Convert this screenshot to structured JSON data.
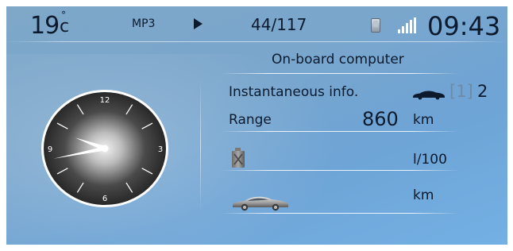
{
  "status_bar": {
    "temperature_value": "19",
    "temperature_unit": "c",
    "temperature_degree": "°",
    "audio_source": "MP3",
    "playback_icon": "play-icon",
    "track_position": "44/117",
    "phone_icon": "phone-icon",
    "signal_icon": "signal-strength-icon",
    "time": "09:43"
  },
  "trip_computer": {
    "title": "On-board computer",
    "info_label": "Instantaneous info.",
    "trip_selector": {
      "inactive": "[1]",
      "active": "2",
      "icon": "car-icon"
    },
    "range": {
      "label": "Range",
      "value": "860",
      "unit": "km"
    },
    "fuel_consumption": {
      "icon": "fuel-can-icon",
      "value": "",
      "unit": "l/100"
    },
    "distance": {
      "icon": "car-icon",
      "value": "",
      "unit": "km"
    }
  },
  "analog_clock": {
    "numerals": [
      "12",
      "3",
      "6",
      "9"
    ],
    "hour": 9,
    "minute": 43
  },
  "colors": {
    "background": "#7aa6cc",
    "text": "#0c1a2e",
    "accent_line": "#ffffff",
    "inactive_text": "#6d8aa6"
  }
}
